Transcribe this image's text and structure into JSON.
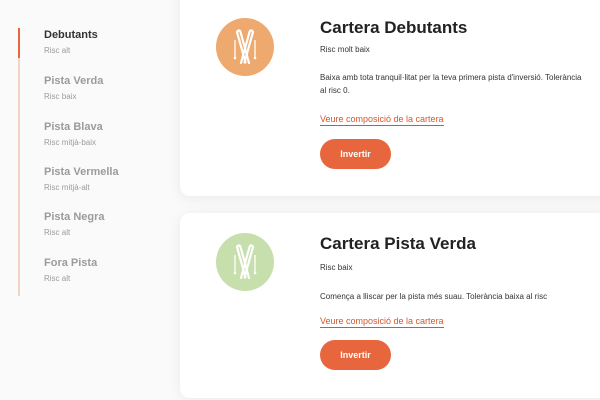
{
  "sidebar": {
    "items": [
      {
        "name": "Debutants",
        "risk": "Risc alt"
      },
      {
        "name": "Pista Verda",
        "risk": "Risc baix"
      },
      {
        "name": "Pista Blava",
        "risk": "Risc mitjà-baix"
      },
      {
        "name": "Pista Vermella",
        "risk": "Risc mitjà-alt"
      },
      {
        "name": "Pista Negra",
        "risk": "Risc alt"
      },
      {
        "name": "Fora Pista",
        "risk": "Risc alt"
      }
    ]
  },
  "cards": [
    {
      "title": "Cartera Debutants",
      "risk": "Risc molt baix",
      "description": "Baixa amb tota tranquil·litat per la teva primera pista d'inversió. Tolerància al risc 0.",
      "link": "Veure composició de la cartera",
      "button": "Invertir",
      "icon": "skis-icon",
      "color": "#eea96e"
    },
    {
      "title": "Cartera Pista Verda",
      "risk": "Risc baix",
      "description": "Comença a lliscar per la pista més suau. Tolerància baixa al risc",
      "link": "Veure composició de la cartera",
      "button": "Invertir",
      "icon": "skis-icon",
      "color": "#c7dfac"
    }
  ],
  "colors": {
    "accent": "#e8663d",
    "link": "#d3572e"
  }
}
